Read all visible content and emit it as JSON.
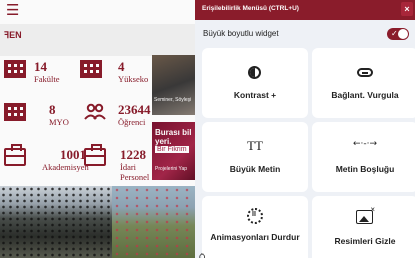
{
  "page": {
    "menu_icon": "hamburger-icon",
    "lang_link": "ꟻEN",
    "stats": [
      {
        "icon": "building-icon",
        "value": "14",
        "label": "Fakülte"
      },
      {
        "icon": "building-icon",
        "value": "4",
        "label": "Yükseko"
      },
      {
        "icon": "building-icon",
        "value": "8",
        "label": "MYO"
      },
      {
        "icon": "people-icon",
        "value": "23644",
        "label": "Öğrenci"
      },
      {
        "icon": "briefcase-icon",
        "value": "1001",
        "label": "Akademisyen"
      },
      {
        "icon": "briefcase-icon",
        "value": "1228",
        "label": "İdari Personel"
      }
    ],
    "photo1_caption": "Seminer, Söyleşi",
    "photo2": {
      "line1": "Burası bil",
      "line2": "yeri.",
      "badge": "Bir Fikrim",
      "small": "Projelerini Yap"
    }
  },
  "panel": {
    "title": "Erişilebilirlik Menüsü (CTRL+U)",
    "close": "×",
    "widget_label": "Büyük boyutlu widget",
    "toggle_on": true,
    "toggle_check": "✓",
    "accent": "#8a1c2b",
    "cards": {
      "contrast": {
        "icon": "contrast-icon",
        "label": "Kontrast +"
      },
      "link": {
        "icon": "link-icon",
        "label": "Bağlant. Vurgula"
      },
      "bigtext": {
        "icon": "text-size-icon",
        "glyph": "TT",
        "label": "Büyük Metin"
      },
      "spacing": {
        "icon": "text-spacing-icon",
        "glyph": "←·-·→",
        "label": "Metin Boşluğu"
      },
      "anim": {
        "icon": "pause-animation-icon",
        "label": "Animasyonları Durdur"
      },
      "images": {
        "icon": "hide-images-icon",
        "label": "Resimleri Gizle"
      }
    }
  },
  "bottom_char": "Ö"
}
